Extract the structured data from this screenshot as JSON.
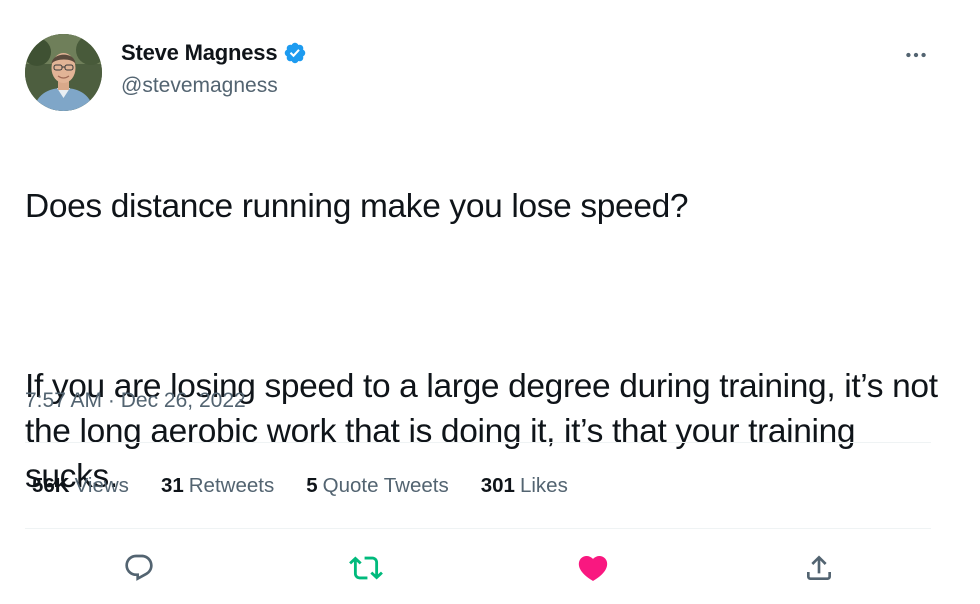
{
  "author": {
    "name": "Steve Magness",
    "handle": "@stevemagness",
    "verified": true
  },
  "tweet": {
    "line1": "Does distance running make you lose speed?",
    "line2": "If you are losing speed to a large degree during training, it’s not the long aerobic work that is doing it, it’s that your training sucks."
  },
  "meta": {
    "time": "7:57 AM",
    "separator": "·",
    "date": "Dec 26, 2022"
  },
  "stats": {
    "views": {
      "count": "56K",
      "label": "Views"
    },
    "retweets": {
      "count": "31",
      "label": "Retweets"
    },
    "quotes": {
      "count": "5",
      "label": "Quote Tweets"
    },
    "likes": {
      "count": "301",
      "label": "Likes"
    }
  },
  "icons": {
    "more": "more-options-icon",
    "reply": "reply-icon",
    "retweet": "retweet-icon",
    "like": "heart-icon",
    "share": "share-icon",
    "verified": "verified-badge-icon"
  },
  "colors": {
    "verified": "#1d9bf0",
    "retweet": "#00ba7c",
    "like": "#f91880",
    "secondary_text": "#536471",
    "icon": "#536471"
  }
}
